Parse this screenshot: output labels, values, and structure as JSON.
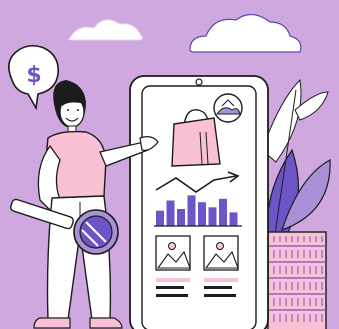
{
  "scene": {
    "currency_symbol": "$",
    "background": "#cfa8e0",
    "colors": {
      "pink": "#f9c1d3",
      "purple": "#6e55c7",
      "lavender": "#a990d6",
      "white": "#ffffff",
      "outline": "#1c1c1c"
    },
    "bar_levels": [
      0.45,
      0.75,
      0.5,
      0.9,
      0.7,
      0.55,
      0.8,
      0.4
    ]
  }
}
